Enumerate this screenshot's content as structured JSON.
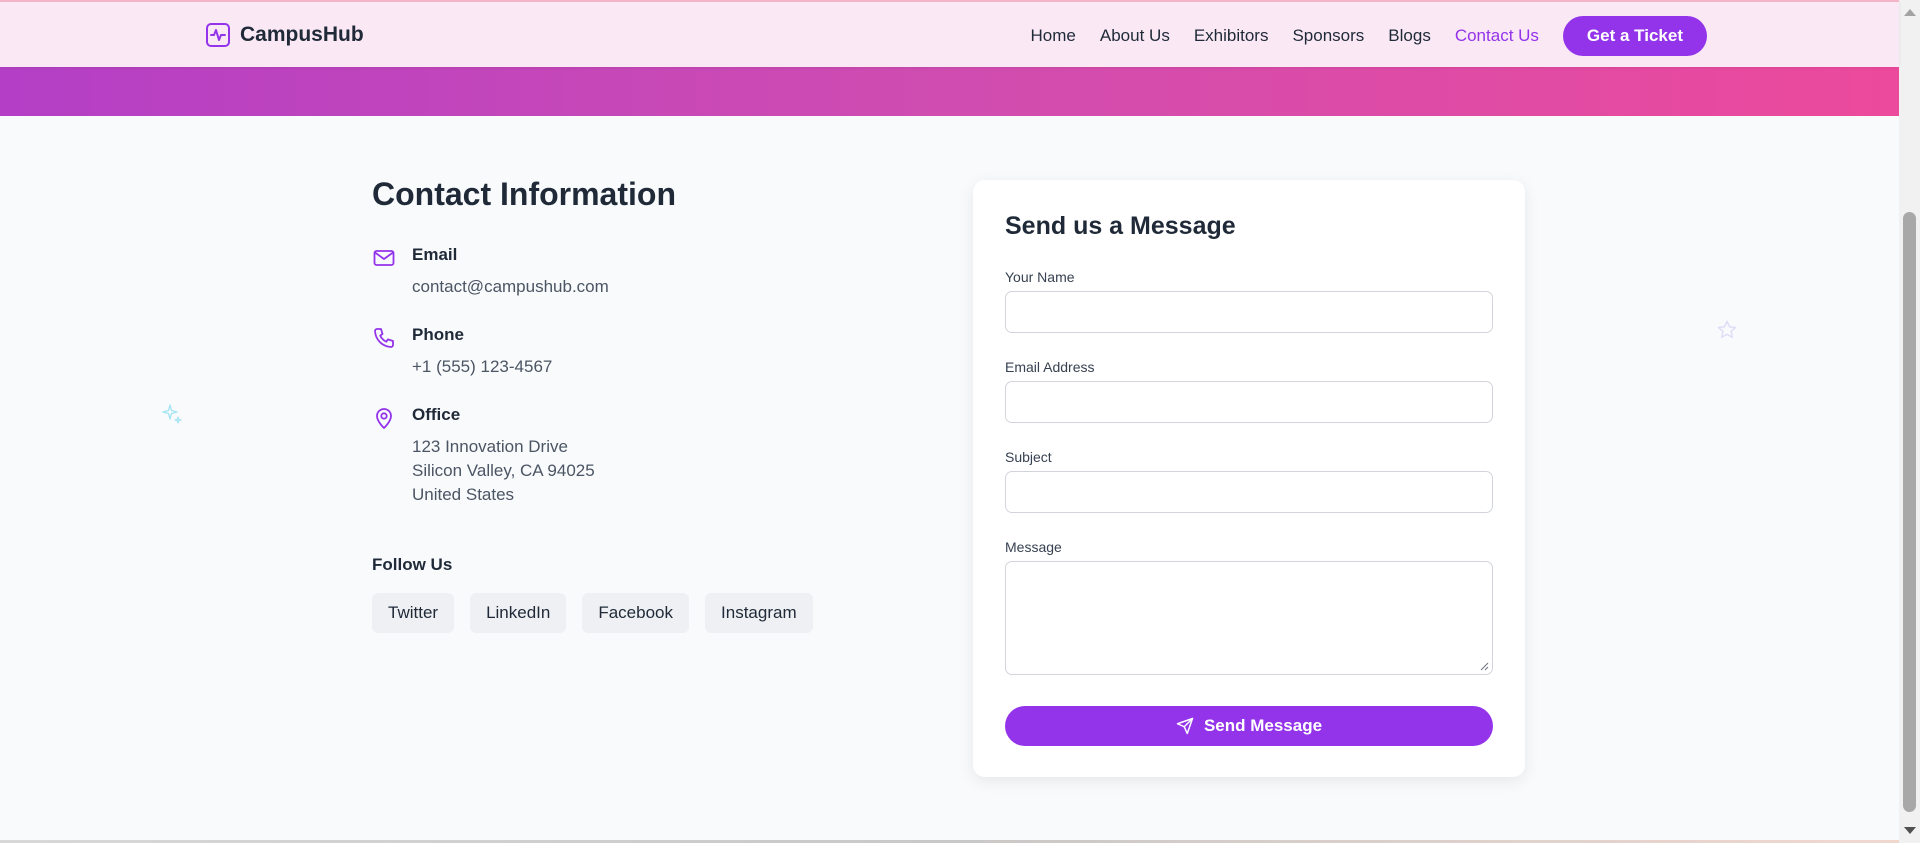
{
  "navbar": {
    "brand": "CampusHub",
    "links": [
      {
        "label": "Home",
        "active": false
      },
      {
        "label": "About Us",
        "active": false
      },
      {
        "label": "Exhibitors",
        "active": false
      },
      {
        "label": "Sponsors",
        "active": false
      },
      {
        "label": "Blogs",
        "active": false
      },
      {
        "label": "Contact Us",
        "active": true
      }
    ],
    "cta_label": "Get a Ticket"
  },
  "contact": {
    "title": "Contact Information",
    "email": {
      "label": "Email",
      "value": "contact@campushub.com",
      "icon": "mail-icon"
    },
    "phone": {
      "label": "Phone",
      "value": "+1 (555) 123-4567",
      "icon": "phone-icon"
    },
    "office": {
      "label": "Office",
      "lines": [
        "123 Innovation Drive",
        "Silicon Valley, CA 94025",
        "United States"
      ],
      "icon": "map-pin-icon"
    },
    "follow_title": "Follow Us",
    "socials": [
      "Twitter",
      "LinkedIn",
      "Facebook",
      "Instagram"
    ]
  },
  "form": {
    "title": "Send us a Message",
    "name_label": "Your Name",
    "name_value": "",
    "email_label": "Email Address",
    "email_value": "",
    "subject_label": "Subject",
    "subject_value": "",
    "message_label": "Message",
    "message_value": "",
    "submit_label": "Send Message",
    "submit_icon": "send-icon"
  },
  "colors": {
    "accent": "#9333ea",
    "navbar_bg": "#fae8f5",
    "band_start": "#b43fc6",
    "band_end": "#ec4a9c",
    "page_bg": "#f8fafc"
  }
}
